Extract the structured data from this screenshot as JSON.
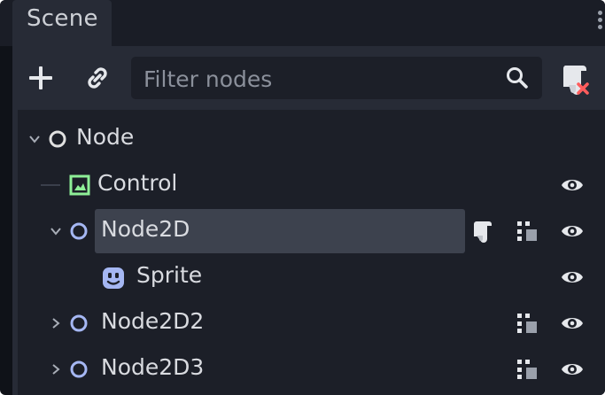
{
  "dock": {
    "tab_label": "Scene"
  },
  "toolbar": {
    "filter_placeholder": "Filter nodes",
    "filter_value": ""
  },
  "tree": {
    "items": [
      {
        "label": "Node",
        "type": "Node",
        "expanded": true,
        "level": 0
      },
      {
        "label": "Control",
        "type": "Control",
        "level": 1,
        "visible": true
      },
      {
        "label": "Node2D",
        "type": "Node2D",
        "expanded": true,
        "level": 1,
        "selected": true,
        "has_script": true,
        "grouped": true,
        "visible": true
      },
      {
        "label": "Sprite",
        "type": "Sprite",
        "level": 2,
        "visible": true
      },
      {
        "label": "Node2D2",
        "type": "Node2D",
        "expanded": false,
        "level": 1,
        "grouped": true,
        "visible": true
      },
      {
        "label": "Node2D3",
        "type": "Node2D",
        "expanded": false,
        "level": 1,
        "grouped": true,
        "visible": true
      }
    ]
  },
  "colors": {
    "control_icon": "#8eef97",
    "sprite_icon": "#a5b7f3",
    "node_icon": "#e0e0e0",
    "script_remove_badge": "#ff5d5d"
  },
  "icons": [
    "add-icon",
    "link-icon",
    "search-icon",
    "remove-script-icon",
    "visibility-icon",
    "script-icon",
    "group-icon"
  ]
}
